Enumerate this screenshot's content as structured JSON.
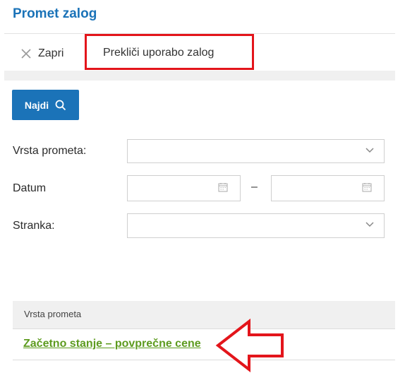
{
  "page": {
    "title": "Promet zalog"
  },
  "toolbar": {
    "close_label": "Zapri",
    "cancel_label": "Prekliči uporabo zalog"
  },
  "search": {
    "find_label": "Najdi"
  },
  "filters": {
    "type_label": "Vrsta prometa:",
    "type_value": "",
    "date_label": "Datum",
    "date_from": "",
    "date_to": "",
    "date_separator": "–",
    "party_label": "Stranka:",
    "party_value": ""
  },
  "table": {
    "column_header": "Vrsta prometa",
    "rows": [
      {
        "label": "Začetno stanje – povprečne cene"
      }
    ]
  },
  "colors": {
    "accent": "#1b73b8",
    "link": "#5d9b1f",
    "annotation": "#e3151b"
  },
  "icons": [
    "close-icon",
    "search-icon",
    "chevron-down-icon",
    "calendar-icon",
    "annotation-arrow"
  ]
}
